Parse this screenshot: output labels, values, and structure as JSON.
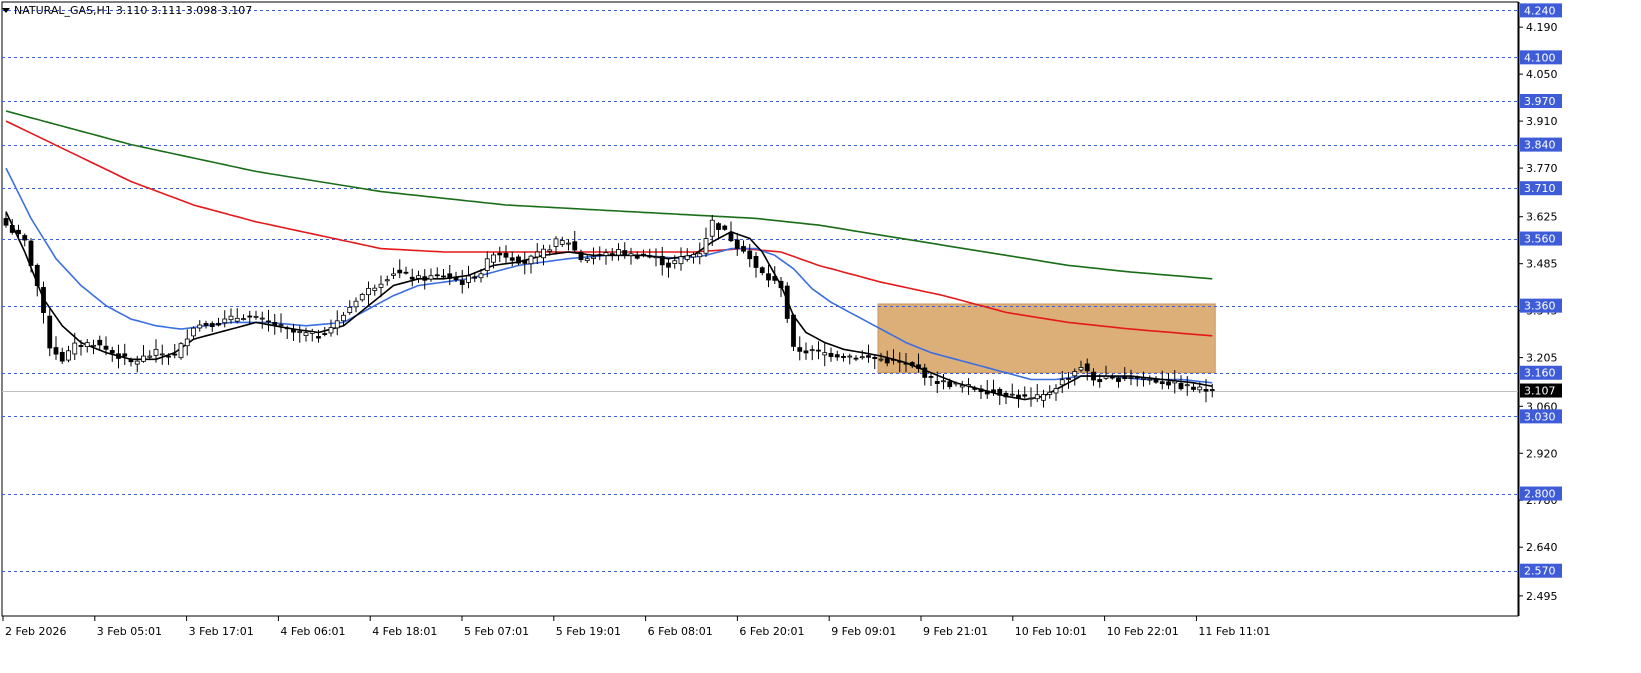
{
  "header": {
    "menu_icon": "triangle-down-icon",
    "symbol_tf": "NATURAL_GAS,H1",
    "ohlc": "3.110 3.111 3.098 3.107"
  },
  "price_axis": {
    "range": [
      2.435,
      4.265
    ],
    "ticks": [
      "4.190",
      "4.050",
      "3.910",
      "3.770",
      "3.625",
      "3.485",
      "3.345",
      "3.205",
      "3.060",
      "2.920",
      "2.780",
      "2.640",
      "2.495"
    ]
  },
  "time_axis": {
    "labels": [
      "2 Feb 2026",
      "3 Feb 05:01",
      "3 Feb 17:01",
      "4 Feb 06:01",
      "4 Feb 18:01",
      "5 Feb 07:01",
      "5 Feb 19:01",
      "6 Feb 08:01",
      "6 Feb 20:01",
      "9 Feb 09:01",
      "9 Feb 21:01",
      "10 Feb 10:01",
      "10 Feb 22:01",
      "11 Feb 11:01"
    ]
  },
  "horizontal_levels": {
    "color": "#3e5bd8",
    "levels": [
      {
        "label": "4.240",
        "price": 4.24
      },
      {
        "label": "4.100",
        "price": 4.1
      },
      {
        "label": "3.970",
        "price": 3.97
      },
      {
        "label": "3.840",
        "price": 3.84
      },
      {
        "label": "3.710",
        "price": 3.71
      },
      {
        "label": "3.560",
        "price": 3.56
      },
      {
        "label": "3.360",
        "price": 3.36
      },
      {
        "label": "3.160",
        "price": 3.16
      },
      {
        "label": "3.030",
        "price": 3.03
      },
      {
        "label": "2.800",
        "price": 2.8
      },
      {
        "label": "2.570",
        "price": 2.57
      }
    ]
  },
  "current_price": {
    "label": "3.107",
    "price": 3.107,
    "color": "#000000"
  },
  "zone": {
    "color": "#dcae78",
    "price_top": 3.365,
    "price_bottom": 3.16,
    "bar_start": 140,
    "bar_end": 193
  },
  "colors": {
    "candle": "#000000",
    "ma_fast": "#000000",
    "ma_mid": "#3b6fe0",
    "ma_slow": "#e5191b",
    "ma_long": "#1a6e1a"
  },
  "chart_data": {
    "type": "candlestick",
    "title": "",
    "symbol": "NATURAL_GAS",
    "timeframe": "H1",
    "ylim": [
      2.435,
      4.265
    ],
    "x_labels": [
      "2 Feb 2026",
      "3 Feb 05:01",
      "3 Feb 17:01",
      "4 Feb 06:01",
      "4 Feb 18:01",
      "5 Feb 07:01",
      "5 Feb 19:01",
      "6 Feb 08:01",
      "6 Feb 20:01",
      "9 Feb 09:01",
      "9 Feb 21:01",
      "10 Feb 10:01",
      "10 Feb 22:01",
      "11 Feb 11:01"
    ],
    "close_anchors": [
      [
        0,
        3.6
      ],
      [
        3,
        3.55
      ],
      [
        5,
        3.42
      ],
      [
        7,
        3.24
      ],
      [
        9,
        3.2
      ],
      [
        11,
        3.24
      ],
      [
        14,
        3.25
      ],
      [
        17,
        3.22
      ],
      [
        20,
        3.19
      ],
      [
        24,
        3.22
      ],
      [
        27,
        3.21
      ],
      [
        30,
        3.3
      ],
      [
        34,
        3.31
      ],
      [
        38,
        3.33
      ],
      [
        42,
        3.31
      ],
      [
        46,
        3.28
      ],
      [
        50,
        3.27
      ],
      [
        53,
        3.31
      ],
      [
        56,
        3.38
      ],
      [
        59,
        3.42
      ],
      [
        62,
        3.46
      ],
      [
        66,
        3.44
      ],
      [
        70,
        3.45
      ],
      [
        73,
        3.43
      ],
      [
        76,
        3.46
      ],
      [
        78,
        3.52
      ],
      [
        80,
        3.51
      ],
      [
        83,
        3.49
      ],
      [
        86,
        3.52
      ],
      [
        88,
        3.55
      ],
      [
        90,
        3.55
      ],
      [
        92,
        3.5
      ],
      [
        95,
        3.51
      ],
      [
        98,
        3.52
      ],
      [
        100,
        3.51
      ],
      [
        102,
        3.51
      ],
      [
        104,
        3.5
      ],
      [
        106,
        3.48
      ],
      [
        108,
        3.5
      ],
      [
        111,
        3.52
      ],
      [
        113,
        3.61
      ],
      [
        115,
        3.58
      ],
      [
        117,
        3.54
      ],
      [
        118,
        3.53
      ],
      [
        120,
        3.47
      ],
      [
        122,
        3.44
      ],
      [
        124,
        3.42
      ],
      [
        126,
        3.23
      ],
      [
        130,
        3.22
      ],
      [
        135,
        3.21
      ],
      [
        140,
        3.2
      ],
      [
        143,
        3.19
      ],
      [
        146,
        3.17
      ],
      [
        148,
        3.14
      ],
      [
        150,
        3.13
      ],
      [
        153,
        3.12
      ],
      [
        156,
        3.11
      ],
      [
        159,
        3.1
      ],
      [
        162,
        3.09
      ],
      [
        164,
        3.08
      ],
      [
        166,
        3.09
      ],
      [
        168,
        3.12
      ],
      [
        170,
        3.15
      ],
      [
        172,
        3.18
      ],
      [
        174,
        3.14
      ],
      [
        177,
        3.14
      ],
      [
        180,
        3.15
      ],
      [
        183,
        3.14
      ],
      [
        186,
        3.13
      ],
      [
        188,
        3.12
      ],
      [
        191,
        3.11
      ],
      [
        193,
        3.107
      ]
    ],
    "moving_averages": [
      {
        "color": "#000000",
        "points": [
          [
            0,
            3.64
          ],
          [
            3,
            3.52
          ],
          [
            6,
            3.38
          ],
          [
            9,
            3.3
          ],
          [
            12,
            3.25
          ],
          [
            16,
            3.22
          ],
          [
            20,
            3.2
          ],
          [
            24,
            3.2
          ],
          [
            27,
            3.22
          ],
          [
            30,
            3.26
          ],
          [
            34,
            3.28
          ],
          [
            40,
            3.31
          ],
          [
            46,
            3.29
          ],
          [
            50,
            3.28
          ],
          [
            54,
            3.3
          ],
          [
            58,
            3.36
          ],
          [
            62,
            3.42
          ],
          [
            66,
            3.44
          ],
          [
            70,
            3.44
          ],
          [
            74,
            3.45
          ],
          [
            78,
            3.48
          ],
          [
            82,
            3.49
          ],
          [
            86,
            3.51
          ],
          [
            90,
            3.52
          ],
          [
            94,
            3.51
          ],
          [
            98,
            3.51
          ],
          [
            102,
            3.51
          ],
          [
            106,
            3.5
          ],
          [
            110,
            3.51
          ],
          [
            113,
            3.55
          ],
          [
            116,
            3.58
          ],
          [
            119,
            3.56
          ],
          [
            121,
            3.52
          ],
          [
            124,
            3.42
          ],
          [
            126,
            3.33
          ],
          [
            128,
            3.28
          ],
          [
            131,
            3.25
          ],
          [
            134,
            3.23
          ],
          [
            137,
            3.22
          ],
          [
            140,
            3.21
          ],
          [
            144,
            3.19
          ],
          [
            148,
            3.16
          ],
          [
            152,
            3.13
          ],
          [
            156,
            3.11
          ],
          [
            160,
            3.09
          ],
          [
            163,
            3.08
          ],
          [
            166,
            3.09
          ],
          [
            169,
            3.12
          ],
          [
            172,
            3.15
          ],
          [
            175,
            3.15
          ],
          [
            180,
            3.15
          ],
          [
            185,
            3.14
          ],
          [
            190,
            3.13
          ],
          [
            193,
            3.12
          ]
        ]
      },
      {
        "color": "#3b6fe0",
        "points": [
          [
            0,
            3.77
          ],
          [
            4,
            3.62
          ],
          [
            8,
            3.5
          ],
          [
            12,
            3.42
          ],
          [
            16,
            3.36
          ],
          [
            20,
            3.32
          ],
          [
            24,
            3.3
          ],
          [
            28,
            3.29
          ],
          [
            32,
            3.3
          ],
          [
            36,
            3.31
          ],
          [
            42,
            3.31
          ],
          [
            48,
            3.3
          ],
          [
            54,
            3.31
          ],
          [
            58,
            3.35
          ],
          [
            62,
            3.39
          ],
          [
            66,
            3.42
          ],
          [
            70,
            3.43
          ],
          [
            74,
            3.44
          ],
          [
            78,
            3.46
          ],
          [
            82,
            3.48
          ],
          [
            86,
            3.49
          ],
          [
            90,
            3.5
          ],
          [
            96,
            3.51
          ],
          [
            102,
            3.51
          ],
          [
            108,
            3.5
          ],
          [
            112,
            3.51
          ],
          [
            116,
            3.53
          ],
          [
            120,
            3.53
          ],
          [
            123,
            3.51
          ],
          [
            126,
            3.47
          ],
          [
            129,
            3.41
          ],
          [
            132,
            3.37
          ],
          [
            136,
            3.33
          ],
          [
            140,
            3.29
          ],
          [
            144,
            3.25
          ],
          [
            148,
            3.22
          ],
          [
            152,
            3.2
          ],
          [
            156,
            3.18
          ],
          [
            160,
            3.16
          ],
          [
            164,
            3.14
          ],
          [
            168,
            3.14
          ],
          [
            172,
            3.15
          ],
          [
            176,
            3.15
          ],
          [
            182,
            3.14
          ],
          [
            188,
            3.14
          ],
          [
            193,
            3.13
          ]
        ]
      },
      {
        "color": "#e5191b",
        "points": [
          [
            0,
            3.91
          ],
          [
            10,
            3.82
          ],
          [
            20,
            3.73
          ],
          [
            30,
            3.66
          ],
          [
            40,
            3.61
          ],
          [
            50,
            3.57
          ],
          [
            60,
            3.53
          ],
          [
            70,
            3.52
          ],
          [
            80,
            3.52
          ],
          [
            90,
            3.52
          ],
          [
            100,
            3.52
          ],
          [
            110,
            3.52
          ],
          [
            118,
            3.53
          ],
          [
            124,
            3.52
          ],
          [
            130,
            3.48
          ],
          [
            140,
            3.43
          ],
          [
            150,
            3.39
          ],
          [
            160,
            3.34
          ],
          [
            170,
            3.31
          ],
          [
            180,
            3.29
          ],
          [
            193,
            3.27
          ]
        ]
      },
      {
        "color": "#1a6e1a",
        "points": [
          [
            0,
            3.94
          ],
          [
            10,
            3.89
          ],
          [
            20,
            3.84
          ],
          [
            30,
            3.8
          ],
          [
            40,
            3.76
          ],
          [
            50,
            3.73
          ],
          [
            60,
            3.7
          ],
          [
            70,
            3.68
          ],
          [
            80,
            3.66
          ],
          [
            90,
            3.65
          ],
          [
            100,
            3.64
          ],
          [
            110,
            3.63
          ],
          [
            120,
            3.62
          ],
          [
            130,
            3.6
          ],
          [
            140,
            3.57
          ],
          [
            150,
            3.54
          ],
          [
            160,
            3.51
          ],
          [
            170,
            3.48
          ],
          [
            180,
            3.46
          ],
          [
            193,
            3.44
          ]
        ]
      }
    ],
    "last_bar": {
      "open": 3.11,
      "high": 3.111,
      "low": 3.098,
      "close": 3.107
    }
  }
}
